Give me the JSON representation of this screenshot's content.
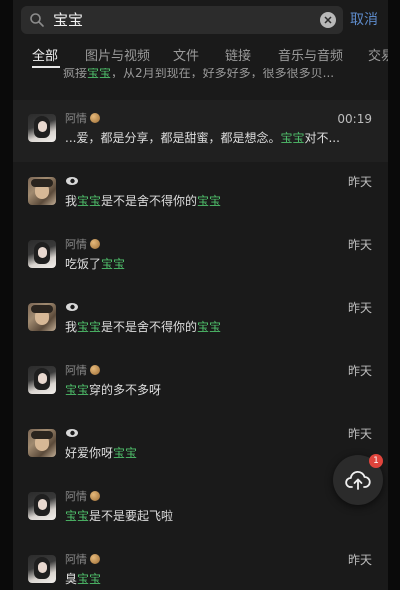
{
  "search": {
    "query": "宝宝",
    "cancel_label": "取消"
  },
  "tabs": [
    {
      "label": "全部",
      "active": true
    },
    {
      "label": "图片与视频",
      "active": false
    },
    {
      "label": "文件",
      "active": false
    },
    {
      "label": "链接",
      "active": false
    },
    {
      "label": "音乐与音频",
      "active": false
    },
    {
      "label": "交易",
      "active": false
    }
  ],
  "partial_row": {
    "prefix": "疯接",
    "highlight": "宝宝",
    "suffix": "，从2月到现在，好多好多，很多很多贝..."
  },
  "results": [
    {
      "avatar": "girl",
      "name": "阿情",
      "time": "00:19",
      "segments": [
        {
          "text": "...爱，都是分享，都是甜蜜，都是想念。",
          "hl": false
        },
        {
          "text": "宝宝",
          "hl": true
        },
        {
          "text": "对不...",
          "hl": false
        }
      ]
    },
    {
      "avatar": "man",
      "name": "",
      "time": "昨天",
      "segments": [
        {
          "text": "我",
          "hl": false
        },
        {
          "text": "宝宝",
          "hl": true
        },
        {
          "text": "是不是舍不得你的",
          "hl": false
        },
        {
          "text": "宝宝",
          "hl": true
        }
      ]
    },
    {
      "avatar": "girl",
      "name": "阿情",
      "time": "昨天",
      "segments": [
        {
          "text": "吃饭了",
          "hl": false
        },
        {
          "text": "宝宝",
          "hl": true
        }
      ]
    },
    {
      "avatar": "man",
      "name": "",
      "time": "昨天",
      "segments": [
        {
          "text": "我",
          "hl": false
        },
        {
          "text": "宝宝",
          "hl": true
        },
        {
          "text": "是不是舍不得你的",
          "hl": false
        },
        {
          "text": "宝宝",
          "hl": true
        }
      ]
    },
    {
      "avatar": "girl",
      "name": "阿情",
      "time": "昨天",
      "segments": [
        {
          "text": "宝宝",
          "hl": true
        },
        {
          "text": "穿的多不多呀",
          "hl": false
        }
      ]
    },
    {
      "avatar": "man",
      "name": "",
      "time": "昨天",
      "segments": [
        {
          "text": "好爱你呀",
          "hl": false
        },
        {
          "text": "宝宝",
          "hl": true
        }
      ]
    },
    {
      "avatar": "girl",
      "name": "阿情",
      "time": "",
      "segments": [
        {
          "text": "宝宝",
          "hl": true
        },
        {
          "text": "是不是要起飞啦",
          "hl": false
        }
      ]
    },
    {
      "avatar": "girl",
      "name": "阿情",
      "time": "昨天",
      "segments": [
        {
          "text": "臭",
          "hl": false
        },
        {
          "text": "宝宝",
          "hl": true
        }
      ]
    }
  ],
  "fab": {
    "icon": "cloud-upload-icon",
    "badge": "1"
  },
  "colors": {
    "highlight": "#4fbf6b",
    "cancel": "#5d8ac9",
    "background": "#1a1a1a",
    "badge": "#e0443c"
  }
}
